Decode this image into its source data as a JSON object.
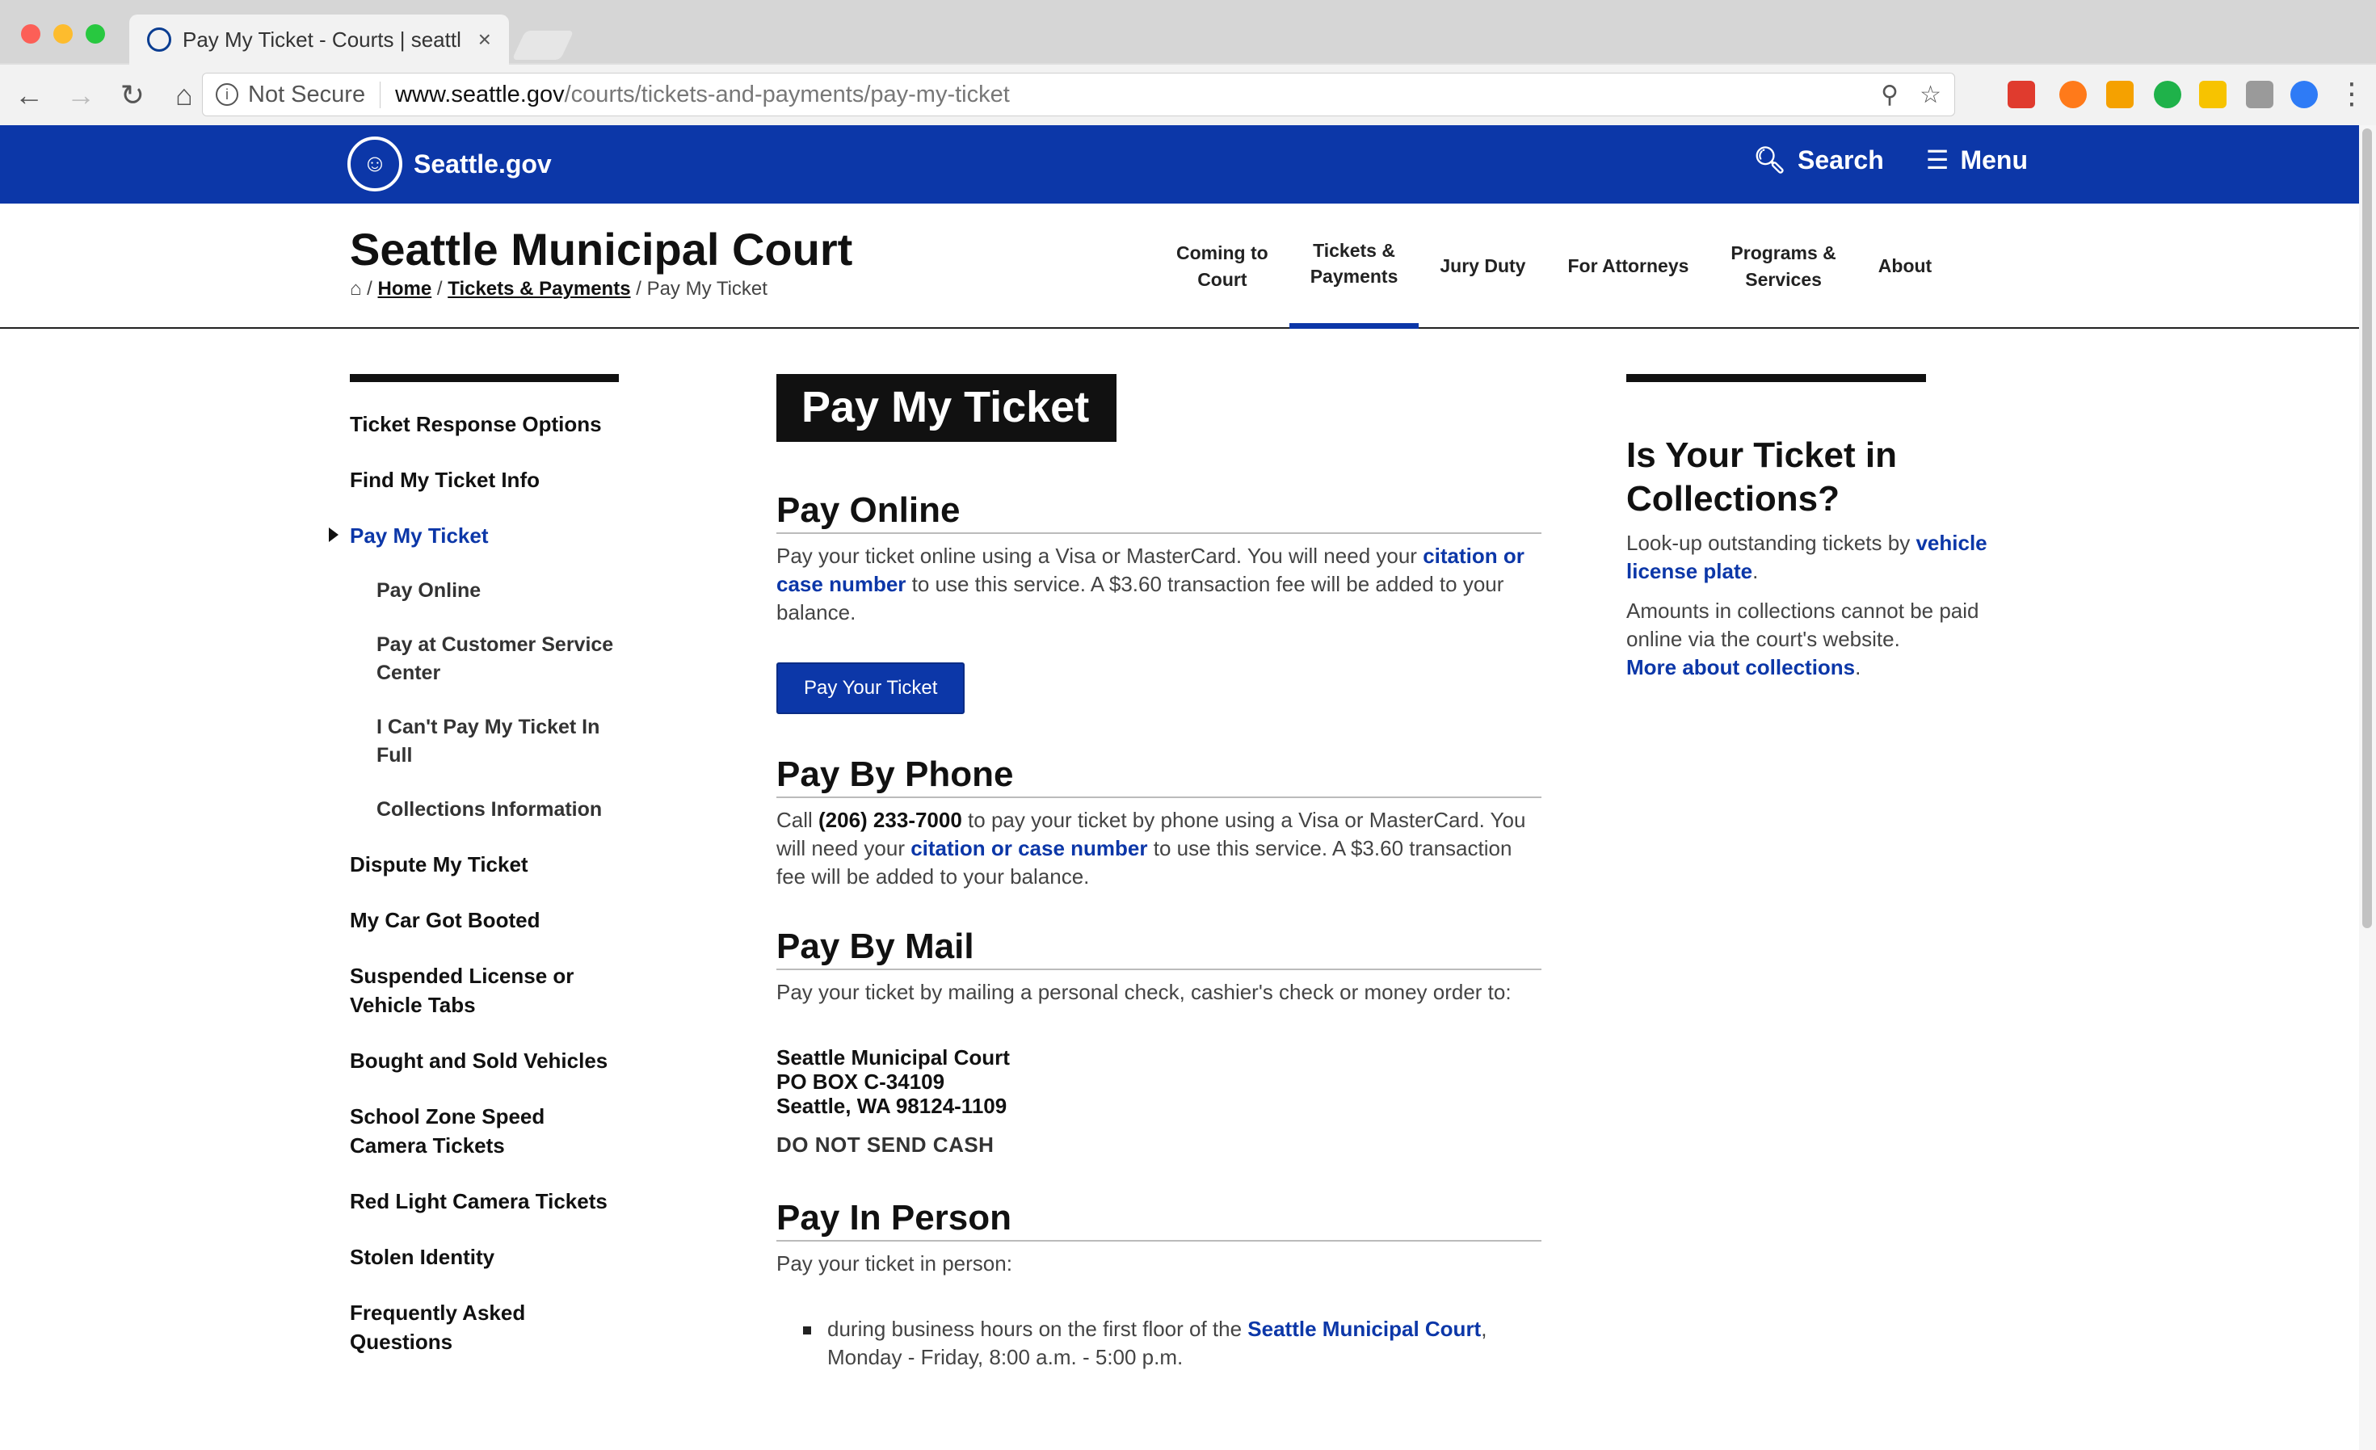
{
  "browser": {
    "tab_title": "Pay My Ticket - Courts | seattl",
    "tab_close": "×",
    "security": "Not Secure",
    "url_host": "www.seattle.gov",
    "url_path": "/courts/tickets-and-payments/pay-my-ticket",
    "icons": [
      "back-icon",
      "forward-icon",
      "reload-icon",
      "home-icon",
      "info-icon",
      "zoom-icon",
      "star-icon",
      "menu-dots-icon"
    ],
    "ext_colors": [
      "#e03b2e",
      "#ff7a1a",
      "#f5a100",
      "#1fb24a",
      "#f7c300",
      "#9a9a9a",
      "#2e7bf6"
    ]
  },
  "site": {
    "logo_text": "Seattle.gov",
    "search": "Search",
    "menu": "Menu",
    "brand_color": "#0c37a8"
  },
  "court": {
    "title": "Seattle Municipal Court",
    "crumb_home": "Home",
    "crumb_tickets": "Tickets & Payments",
    "crumb_current": "Pay My Ticket",
    "sep": "/"
  },
  "topnav": [
    {
      "line1": "Coming to",
      "line2": "Court"
    },
    {
      "line1": "Tickets &",
      "line2": "Payments"
    },
    {
      "line1": "Jury Duty",
      "line2": ""
    },
    {
      "line1": "For Attorneys",
      "line2": ""
    },
    {
      "line1": "Programs &",
      "line2": "Services"
    },
    {
      "line1": "About",
      "line2": ""
    }
  ],
  "leftnav": {
    "items": [
      "Ticket Response Options",
      "Find My Ticket Info",
      "Pay My Ticket",
      "Pay Online",
      "Pay at Customer Service Center",
      "I Can't Pay My Ticket In Full",
      "Collections Information",
      "Dispute My Ticket",
      "My Car Got Booted",
      "Suspended License or Vehicle Tabs",
      "Bought and Sold Vehicles",
      "School Zone Speed Camera Tickets",
      "Red Light Camera Tickets",
      "Stolen Identity",
      "Frequently Asked Questions"
    ]
  },
  "main": {
    "page_title": "Pay My Ticket",
    "online": {
      "heading": "Pay Online",
      "text1": "Pay your ticket online using a Visa or MasterCard. You will need your ",
      "link": "citation or case number",
      "text2": " to use this service. A $3.60 transaction fee will be added to your balance.",
      "button": "Pay Your Ticket"
    },
    "phone": {
      "heading": "Pay By Phone",
      "text1": "Call ",
      "number": "(206) 233-7000",
      "text2": " to pay your ticket by phone using a Visa or MasterCard. You will need your ",
      "link": "citation or case number",
      "text3": " to use this service. A $3.60 transaction fee will be added to your balance."
    },
    "mail": {
      "heading": "Pay By Mail",
      "text": "Pay your ticket by mailing a personal check, cashier's check or money order to:",
      "addr1": "Seattle Municipal Court",
      "addr2": "PO BOX C-34109",
      "addr3": "Seattle, WA 98124-1109",
      "warning": "DO NOT SEND CASH"
    },
    "person": {
      "heading": "Pay In Person",
      "text": "Pay your ticket in person:",
      "bullet1": "during business hours on the first floor of the ",
      "bullet_link": "Seattle Municipal Court",
      "bullet2": ",",
      "bullet3": "Monday - Friday, 8:00 a.m. - 5:00 p.m."
    }
  },
  "sidebar": {
    "heading": "Is Your Ticket in Collections?",
    "p1_text": "Look-up outstanding tickets by ",
    "p1_link": "vehicle license plate",
    "p1_end": ".",
    "p2_text": "Amounts in collections cannot be paid online via the court's website.",
    "p2_link": "More about collections",
    "p2_end": "."
  }
}
